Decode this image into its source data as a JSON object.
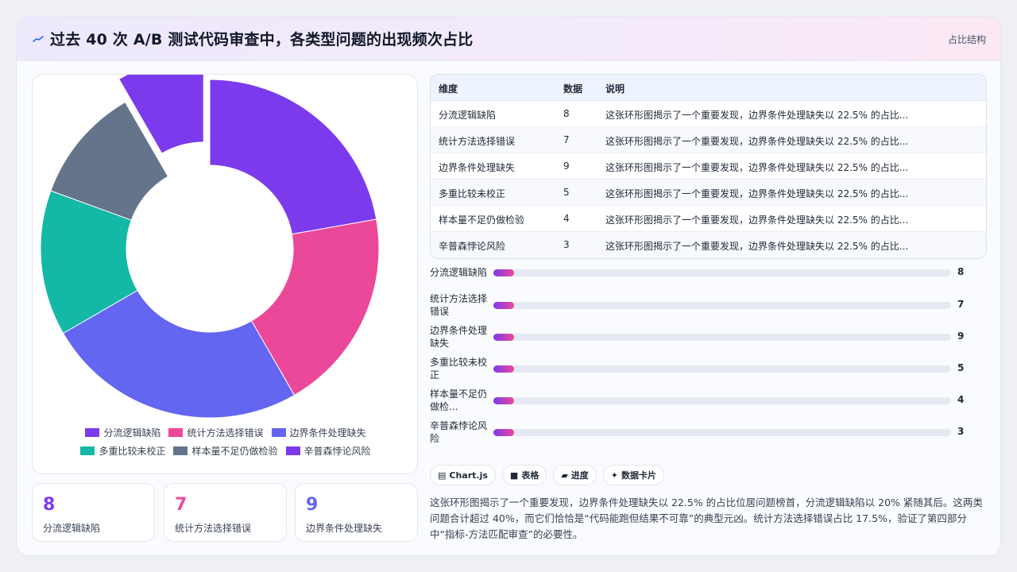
{
  "header": {
    "title": "过去 40 次 A/B 测试代码审查中，各类型问题的出现频次占比",
    "badge": "占比结构"
  },
  "chart_data": {
    "type": "pie",
    "categories": [
      "分流逻辑缺陷",
      "统计方法选择错误",
      "边界条件处理缺失",
      "多重比较未校正",
      "样本量不足仍做检验",
      "辛普森悖论风险"
    ],
    "values": [
      8,
      7,
      9,
      5,
      4,
      3
    ],
    "colors": [
      "#7c3aed",
      "#ec4899",
      "#6366f1",
      "#14b8a6",
      "#64748b",
      "#7c3aed"
    ],
    "exploded_index": 5,
    "legend": "bottom"
  },
  "legend": [
    {
      "label": "分流逻辑缺陷",
      "color": "#7c3aed"
    },
    {
      "label": "统计方法选择错误",
      "color": "#ec4899"
    },
    {
      "label": "边界条件处理缺失",
      "color": "#6366f1"
    },
    {
      "label": "多重比较未校正",
      "color": "#14b8a6"
    },
    {
      "label": "样本量不足仍做检验",
      "color": "#64748b"
    },
    {
      "label": "辛普森悖论风险",
      "color": "#7c3aed"
    }
  ],
  "stats": [
    {
      "value": "8",
      "label": "分流逻辑缺陷",
      "color": "#7c3aed"
    },
    {
      "value": "7",
      "label": "统计方法选择错误",
      "color": "#ec4899"
    },
    {
      "value": "9",
      "label": "边界条件处理缺失",
      "color": "#6366f1"
    }
  ],
  "table": {
    "headers": [
      "维度",
      "数据",
      "说明"
    ],
    "rows": [
      [
        "分流逻辑缺陷",
        "8",
        "这张环形图揭示了一个重要发现，边界条件处理缺失以 22.5% 的占比..."
      ],
      [
        "统计方法选择错误",
        "7",
        "这张环形图揭示了一个重要发现，边界条件处理缺失以 22.5% 的占比..."
      ],
      [
        "边界条件处理缺失",
        "9",
        "这张环形图揭示了一个重要发现，边界条件处理缺失以 22.5% 的占比..."
      ],
      [
        "多重比较未校正",
        "5",
        "这张环形图揭示了一个重要发现，边界条件处理缺失以 22.5% 的占比..."
      ],
      [
        "样本量不足仍做检验",
        "4",
        "这张环形图揭示了一个重要发现，边界条件处理缺失以 22.5% 的占比..."
      ],
      [
        "辛普森悖论风险",
        "3",
        "这张环形图揭示了一个重要发现，边界条件处理缺失以 22.5% 的占比..."
      ]
    ]
  },
  "progress": {
    "max": 200,
    "items": [
      {
        "label_lines": [
          "分流逻辑缺陷"
        ],
        "value": 8
      },
      {
        "label_lines": [
          "统计方法选择",
          "错误"
        ],
        "value": 7
      },
      {
        "label_lines": [
          "边界条件处理",
          "缺失"
        ],
        "value": 9
      },
      {
        "label_lines": [
          "多重比较未校",
          "正"
        ],
        "value": 5
      },
      {
        "label_lines": [
          "样本量不足仍",
          "做检..."
        ],
        "value": 4
      },
      {
        "label_lines": [
          "辛普森悖论风",
          "险"
        ],
        "value": 3
      }
    ]
  },
  "tags": [
    {
      "icon": "▤",
      "icon_name": "chart-icon",
      "label": "Chart.js"
    },
    {
      "icon": "■",
      "icon_name": "table-icon",
      "label": "表格"
    },
    {
      "icon": "▰",
      "icon_name": "progress-icon",
      "label": "进度"
    },
    {
      "icon": "✦",
      "icon_name": "sparkle-icon",
      "label": "数据卡片"
    }
  ],
  "summary": "这张环形图揭示了一个重要发现，边界条件处理缺失以 22.5% 的占比位居问题榜首，分流逻辑缺陷以 20% 紧随其后。这两类问题合计超过 40%，而它们恰恰是“代码能跑但结果不可靠”的典型元凶。统计方法选择错误占比 17.5%，验证了第四部分中“指标-方法匹配审查”的必要性。"
}
